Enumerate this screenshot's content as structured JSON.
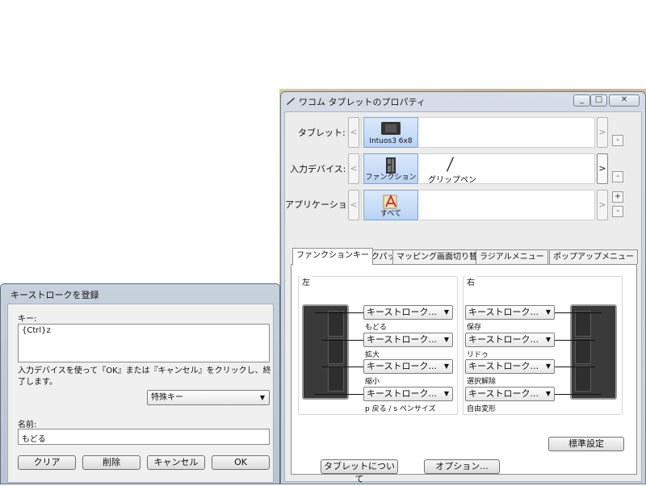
{
  "main_window": {
    "title": "ワコム タブレットのプロパティ",
    "controls": {
      "minimize": "_",
      "maximize": "□",
      "close": "✕"
    },
    "rows": {
      "tablet": {
        "label": "タブレット:",
        "tile_label": "Intuos3 6x8",
        "icon": "tablet-icon"
      },
      "input_device": {
        "label": "入力デバイス:",
        "tile_label": "ファンクション",
        "icon": "function-keys-icon",
        "second_label": "グリップペン",
        "second_icon": "pen-icon"
      },
      "application": {
        "label": "アプリケーション:",
        "tile_label": "すべて",
        "icon": "all-apps-icon"
      }
    },
    "nav": {
      "prev": "<",
      "next": ">",
      "plus": "+",
      "minus": "-"
    },
    "tabs": [
      "ファンクションキー",
      "トラックパッド",
      "マッピング画面切り替え",
      "ラジアルメニュー",
      "ポップアップメニュー"
    ],
    "selected_tab": 0,
    "left_group": {
      "label": "左",
      "keys": [
        {
          "value": "キーストローク...",
          "caption": "もどる"
        },
        {
          "value": "キーストローク...",
          "caption": "拡大"
        },
        {
          "value": "キーストローク...",
          "caption": "縮小"
        },
        {
          "value": "キーストローク...",
          "caption": "p 戻る / s ペンサイズ"
        }
      ]
    },
    "right_group": {
      "label": "右",
      "keys": [
        {
          "value": "キーストローク...",
          "caption": "保存"
        },
        {
          "value": "キーストローク...",
          "caption": "リドゥ"
        },
        {
          "value": "キーストローク...",
          "caption": "選択解除"
        },
        {
          "value": "キーストローク...",
          "caption": "自由変形"
        }
      ]
    },
    "default_button": "標準設定",
    "about_button": "タブレットについて",
    "options_button": "オプション..."
  },
  "keystroke_dialog": {
    "title": "キーストロークを登録",
    "key_label": "キー:",
    "key_value": "{Ctrl}z",
    "instruction": "入力デバイスを使って『OK』または『キャンセル』をクリックし、終了します。",
    "special_keys": "特殊キー",
    "name_label": "名前:",
    "name_value": "もどる",
    "buttons": {
      "clear": "クリア",
      "delete": "削除",
      "cancel": "キャンセル",
      "ok": "OK"
    }
  },
  "colors": {
    "tile_fill": "#c8defa",
    "tile_border": "#7da2ce",
    "title_bar": "#c9d3df"
  }
}
